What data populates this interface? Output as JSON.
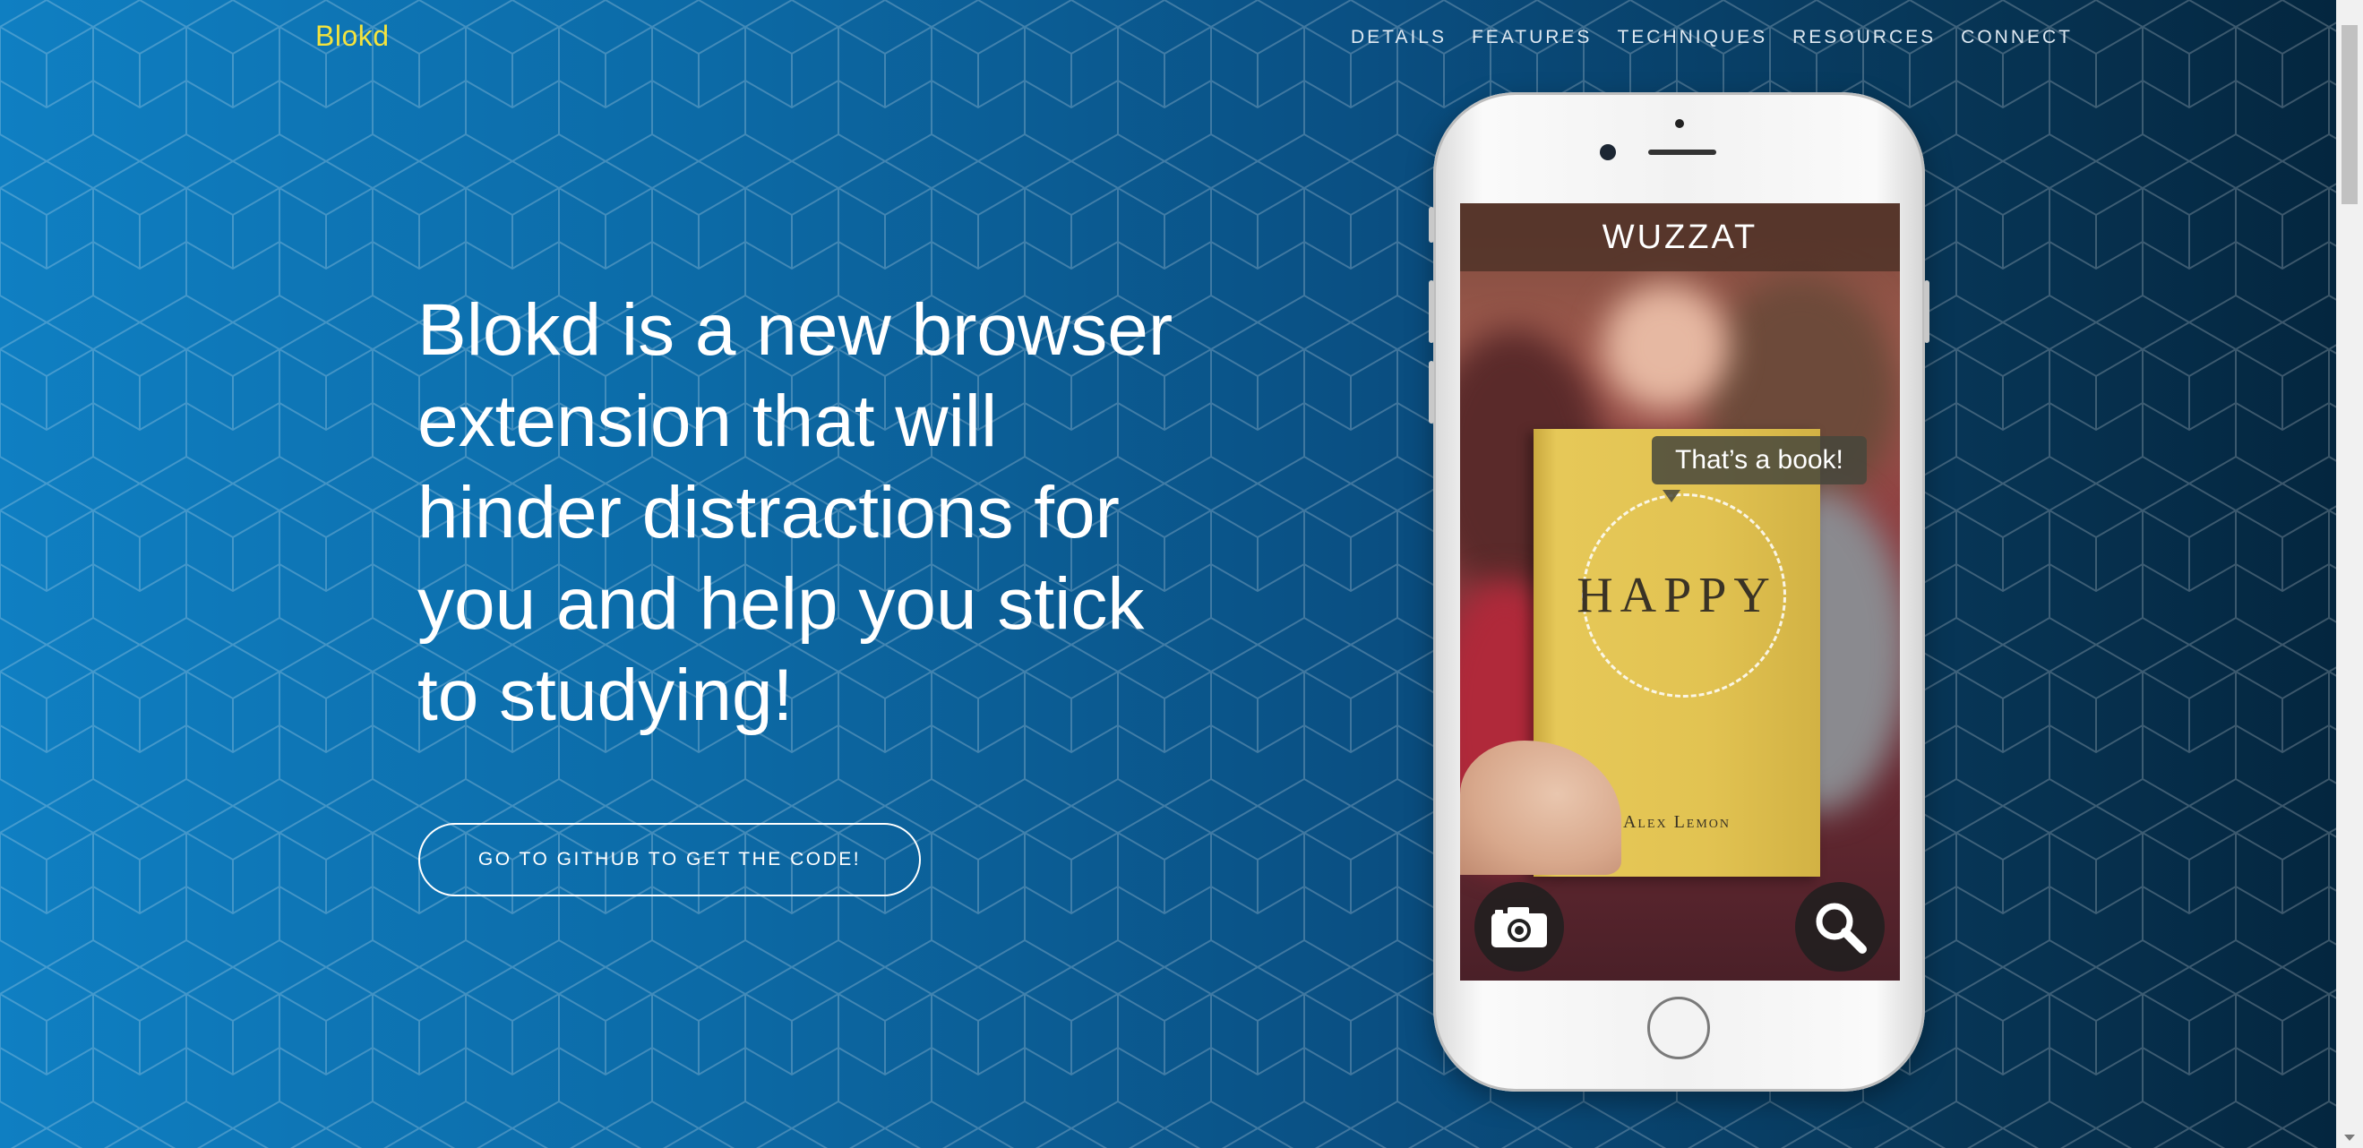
{
  "nav": {
    "brand": "Blokd",
    "items": [
      {
        "label": "DETAILS"
      },
      {
        "label": "FEATURES"
      },
      {
        "label": "TECHNIQUES"
      },
      {
        "label": "RESOURCES"
      },
      {
        "label": "CONNECT"
      }
    ]
  },
  "hero": {
    "lines": [
      "Blokd is a new browser",
      "extension that will",
      "hinder distractions for",
      "you and help you stick",
      "to studying!"
    ],
    "cta_label": "GO TO GITHUB TO GET THE CODE!"
  },
  "phone": {
    "app_title": "WUZZAT",
    "bubble_text": "That’s a book!",
    "book_title": "HAPPY",
    "book_author": "Alex Lemon",
    "camera_icon": "camera-icon",
    "search_icon": "magnifier-icon"
  },
  "colors": {
    "brand": "#f4e33d",
    "gradient_start": "#0f7fc2",
    "gradient_end": "#04253d"
  }
}
